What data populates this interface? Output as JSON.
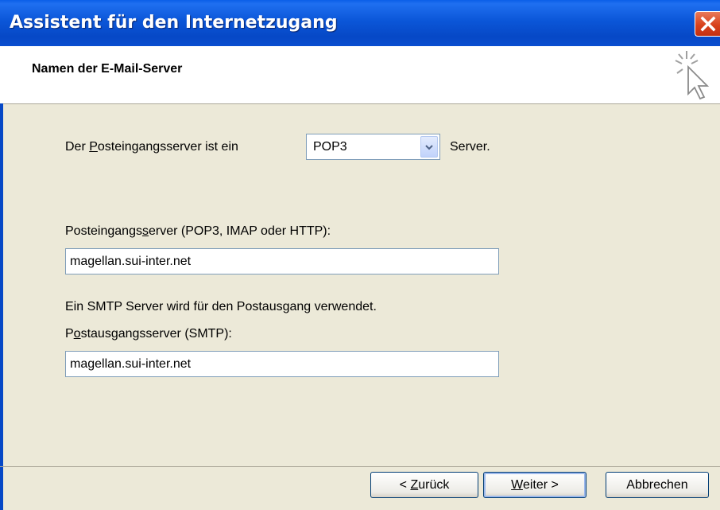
{
  "window": {
    "title": "Assistent für den Internetzugang"
  },
  "header": {
    "title": "Namen der E-Mail-Server"
  },
  "incoming_type": {
    "label_pre": "Der ",
    "label_mnemonic": "P",
    "label_post": "osteingangsserver ist ein",
    "selected": "POP3",
    "suffix": "Server."
  },
  "incoming_server": {
    "label_pre": "Posteingangs",
    "label_mnemonic": "s",
    "label_post": "erver (POP3, IMAP oder HTTP):",
    "value": "magellan.sui-inter.net"
  },
  "smtp_note": "Ein SMTP Server wird für den Postausgang verwendet.",
  "outgoing_server": {
    "label_pre": "P",
    "label_mnemonic": "o",
    "label_post": "stausgangsserver (SMTP):",
    "value": "magellan.sui-inter.net"
  },
  "buttons": {
    "back_pre": "< ",
    "back_mnemonic": "Z",
    "back_post": "urück",
    "next_mnemonic": "W",
    "next_post": "eiter >",
    "cancel": "Abbrechen"
  },
  "icons": {
    "close": "close-icon",
    "wizard": "wizard-cursor-icon",
    "dropdown": "chevron-down-icon"
  }
}
